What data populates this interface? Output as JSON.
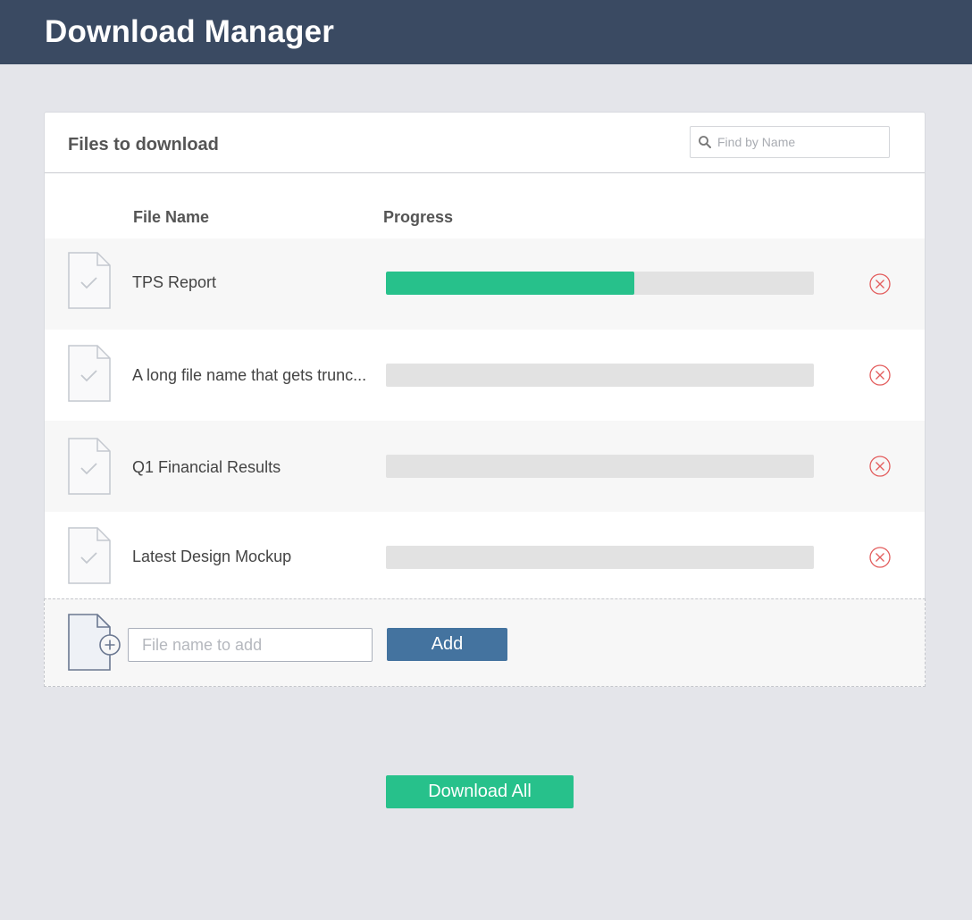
{
  "app": {
    "title": "Download Manager"
  },
  "panel": {
    "title": "Files to download",
    "search": {
      "placeholder": "Find by Name",
      "value": ""
    }
  },
  "table": {
    "columns": {
      "file_name": "File Name",
      "progress": "Progress"
    },
    "rows": [
      {
        "name": "TPS Report",
        "progress": 0.58
      },
      {
        "name": "A long file name that gets trunc...",
        "progress": 0
      },
      {
        "name": "Q1 Financial Results",
        "progress": 0
      },
      {
        "name": "Latest Design Mockup",
        "progress": 0
      }
    ]
  },
  "add_form": {
    "placeholder": "File name to add",
    "value": "",
    "button_label": "Add"
  },
  "actions": {
    "download_all_label": "Download All"
  },
  "icons": {
    "row_file": "file-check-icon",
    "remove": "remove-circle-x-icon",
    "add_file": "file-add-icon",
    "search": "search-icon"
  },
  "colors": {
    "header_bg": "#3a4a62",
    "progress_fill": "#27c18b",
    "add_button": "#44739f",
    "download_all": "#27c18b",
    "remove_icon": "#e35d5d"
  }
}
